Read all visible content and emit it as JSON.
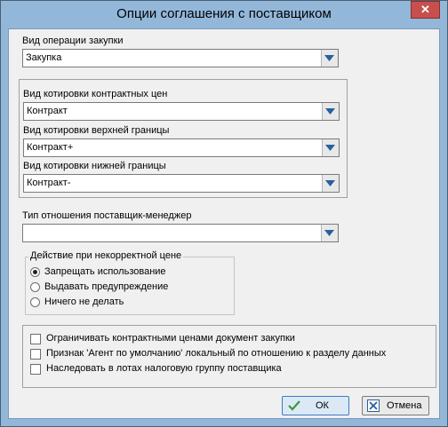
{
  "window": {
    "title": "Опции соглашения с поставщиком",
    "close_glyph": "✕"
  },
  "purchase_op": {
    "label": "Вид операции закупки",
    "value": "Закупка"
  },
  "contract_price_quote": {
    "label": "Вид котировки контрактных цен",
    "value": "Контракт"
  },
  "upper_bound_quote": {
    "label": "Вид котировки верхней границы",
    "value": "Контракт+"
  },
  "lower_bound_quote": {
    "label": "Вид котировки нижней границы",
    "value": "Контракт-"
  },
  "supplier_manager": {
    "label": "Тип отношения поставщик-менеджер",
    "value": ""
  },
  "incorrect_price": {
    "legend": "Действие при некорректной цене",
    "options": [
      "Запрещать использование",
      "Выдавать предупреждение",
      "Ничего не делать"
    ],
    "selected_index": 0
  },
  "checkboxes": [
    {
      "label": "Ограничивать контрактными ценами документ закупки",
      "checked": false
    },
    {
      "label": "Признак 'Агент по умолчанию' локальный по отношению к разделу данных",
      "checked": false
    },
    {
      "label": "Наследовать в лотах налоговую группу поставщика",
      "checked": false
    }
  ],
  "buttons": {
    "ok": "ОК",
    "cancel": "Отмена"
  },
  "colors": {
    "title_bar": "#93b7d9",
    "close_button": "#c7504c",
    "combo_arrow": "#2a5f9e",
    "ok_check": "#3a9a3a",
    "cancel_x": "#2a5f9e"
  }
}
